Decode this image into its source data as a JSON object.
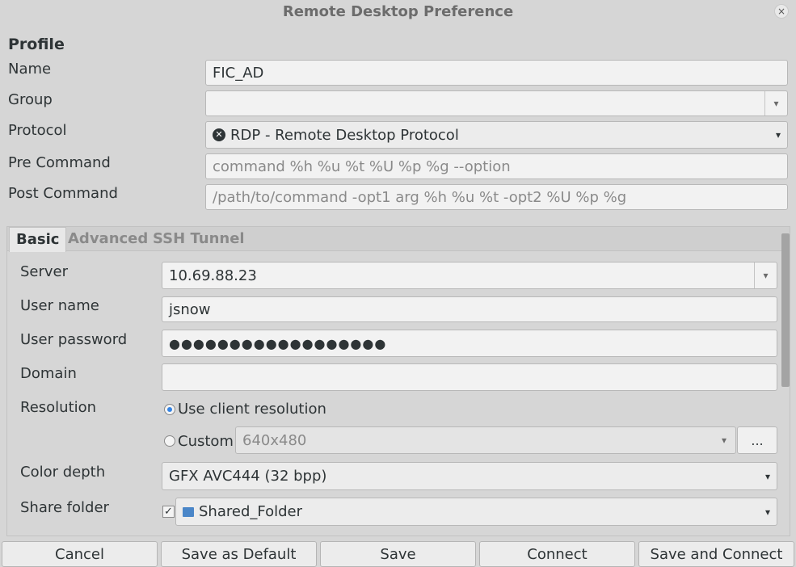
{
  "window": {
    "title": "Remote Desktop Preference",
    "close_label": "×"
  },
  "profile": {
    "section_title": "Profile",
    "name_label": "Name",
    "name_value": "FIC_AD",
    "group_label": "Group",
    "group_value": "",
    "protocol_label": "Protocol",
    "protocol_value": "RDP - Remote Desktop Protocol",
    "precommand_label": "Pre Command",
    "precommand_placeholder": "command %h %u %t %U %p %g --option",
    "postcommand_label": "Post Command",
    "postcommand_placeholder": "/path/to/command -opt1 arg %h %u %t -opt2 %U %p %g"
  },
  "tabs": [
    {
      "label": "Basic",
      "active": true
    },
    {
      "label": "Advanced",
      "active": false
    },
    {
      "label": "SSH Tunnel",
      "active": false
    }
  ],
  "basic": {
    "server_label": "Server",
    "server_value": "10.69.88.23",
    "username_label": "User name",
    "username_value": "jsnow",
    "password_label": "User password",
    "password_value": "●●●●●●●●●●●●●●●●●●",
    "domain_label": "Domain",
    "domain_value": "",
    "resolution_label": "Resolution",
    "use_client_resolution": "Use client resolution",
    "custom_label": "Custom",
    "custom_resolution": "640x480",
    "resolution_more": "...",
    "colordepth_label": "Color depth",
    "colordepth_value": "GFX AVC444 (32 bpp)",
    "sharefolder_label": "Share folder",
    "sharefolder_value": "Shared_Folder"
  },
  "buttons": {
    "cancel": "Cancel",
    "save_default": "Save as Default",
    "save": "Save",
    "connect": "Connect",
    "save_connect": "Save and Connect"
  },
  "icons": {
    "arrow": "▾",
    "check": "✓",
    "protocol": "✕"
  },
  "colors": {
    "accent": "#3584e4",
    "folder": "#4a86c8"
  }
}
